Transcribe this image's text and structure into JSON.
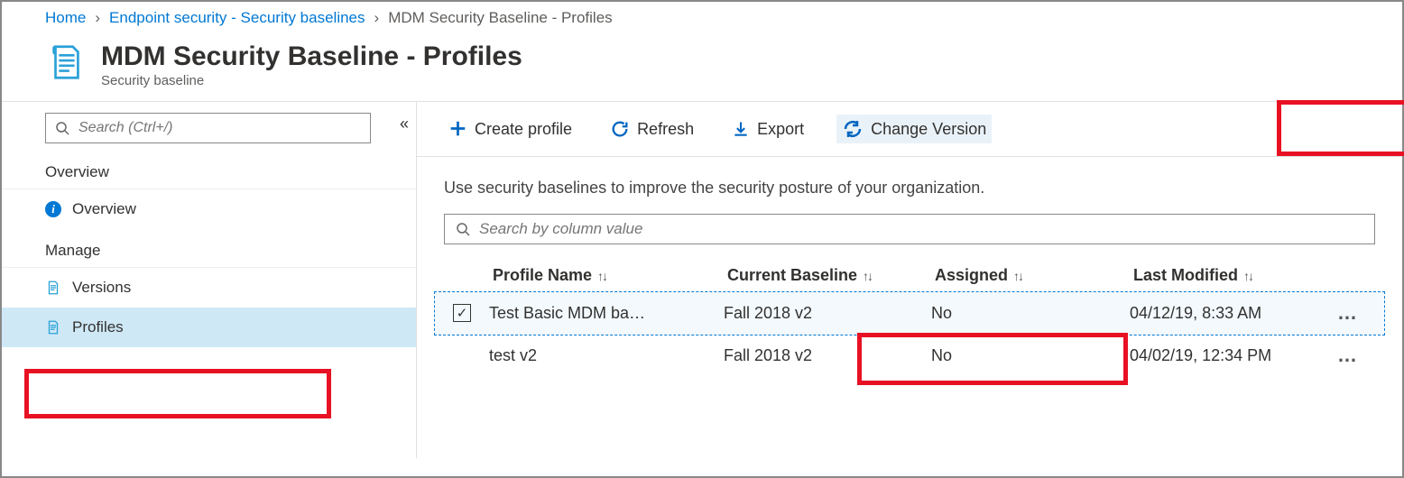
{
  "breadcrumb": {
    "home": "Home",
    "endpoint": "Endpoint security - Security baselines",
    "current": "MDM Security Baseline - Profiles"
  },
  "header": {
    "title": "MDM Security Baseline - Profiles",
    "subtitle": "Security baseline"
  },
  "sidebar": {
    "search_placeholder": "Search (Ctrl+/)",
    "overview_section": "Overview",
    "overview_item": "Overview",
    "manage_section": "Manage",
    "versions_item": "Versions",
    "profiles_item": "Profiles"
  },
  "toolbar": {
    "create": "Create profile",
    "refresh": "Refresh",
    "export": "Export",
    "change_version": "Change Version"
  },
  "description": "Use security baselines to improve the security posture of your organization.",
  "column_search_placeholder": "Search by column value",
  "columns": {
    "profile_name": "Profile Name",
    "current_baseline": "Current Baseline",
    "assigned": "Assigned",
    "last_modified": "Last Modified"
  },
  "rows": [
    {
      "selected": true,
      "profile_name": "Test Basic MDM ba…",
      "current_baseline": "Fall 2018 v2",
      "assigned": "No",
      "last_modified": "04/12/19, 8:33 AM"
    },
    {
      "selected": false,
      "profile_name": "test v2",
      "current_baseline": "Fall 2018 v2",
      "assigned": "No",
      "last_modified": "04/02/19, 12:34 PM"
    }
  ]
}
